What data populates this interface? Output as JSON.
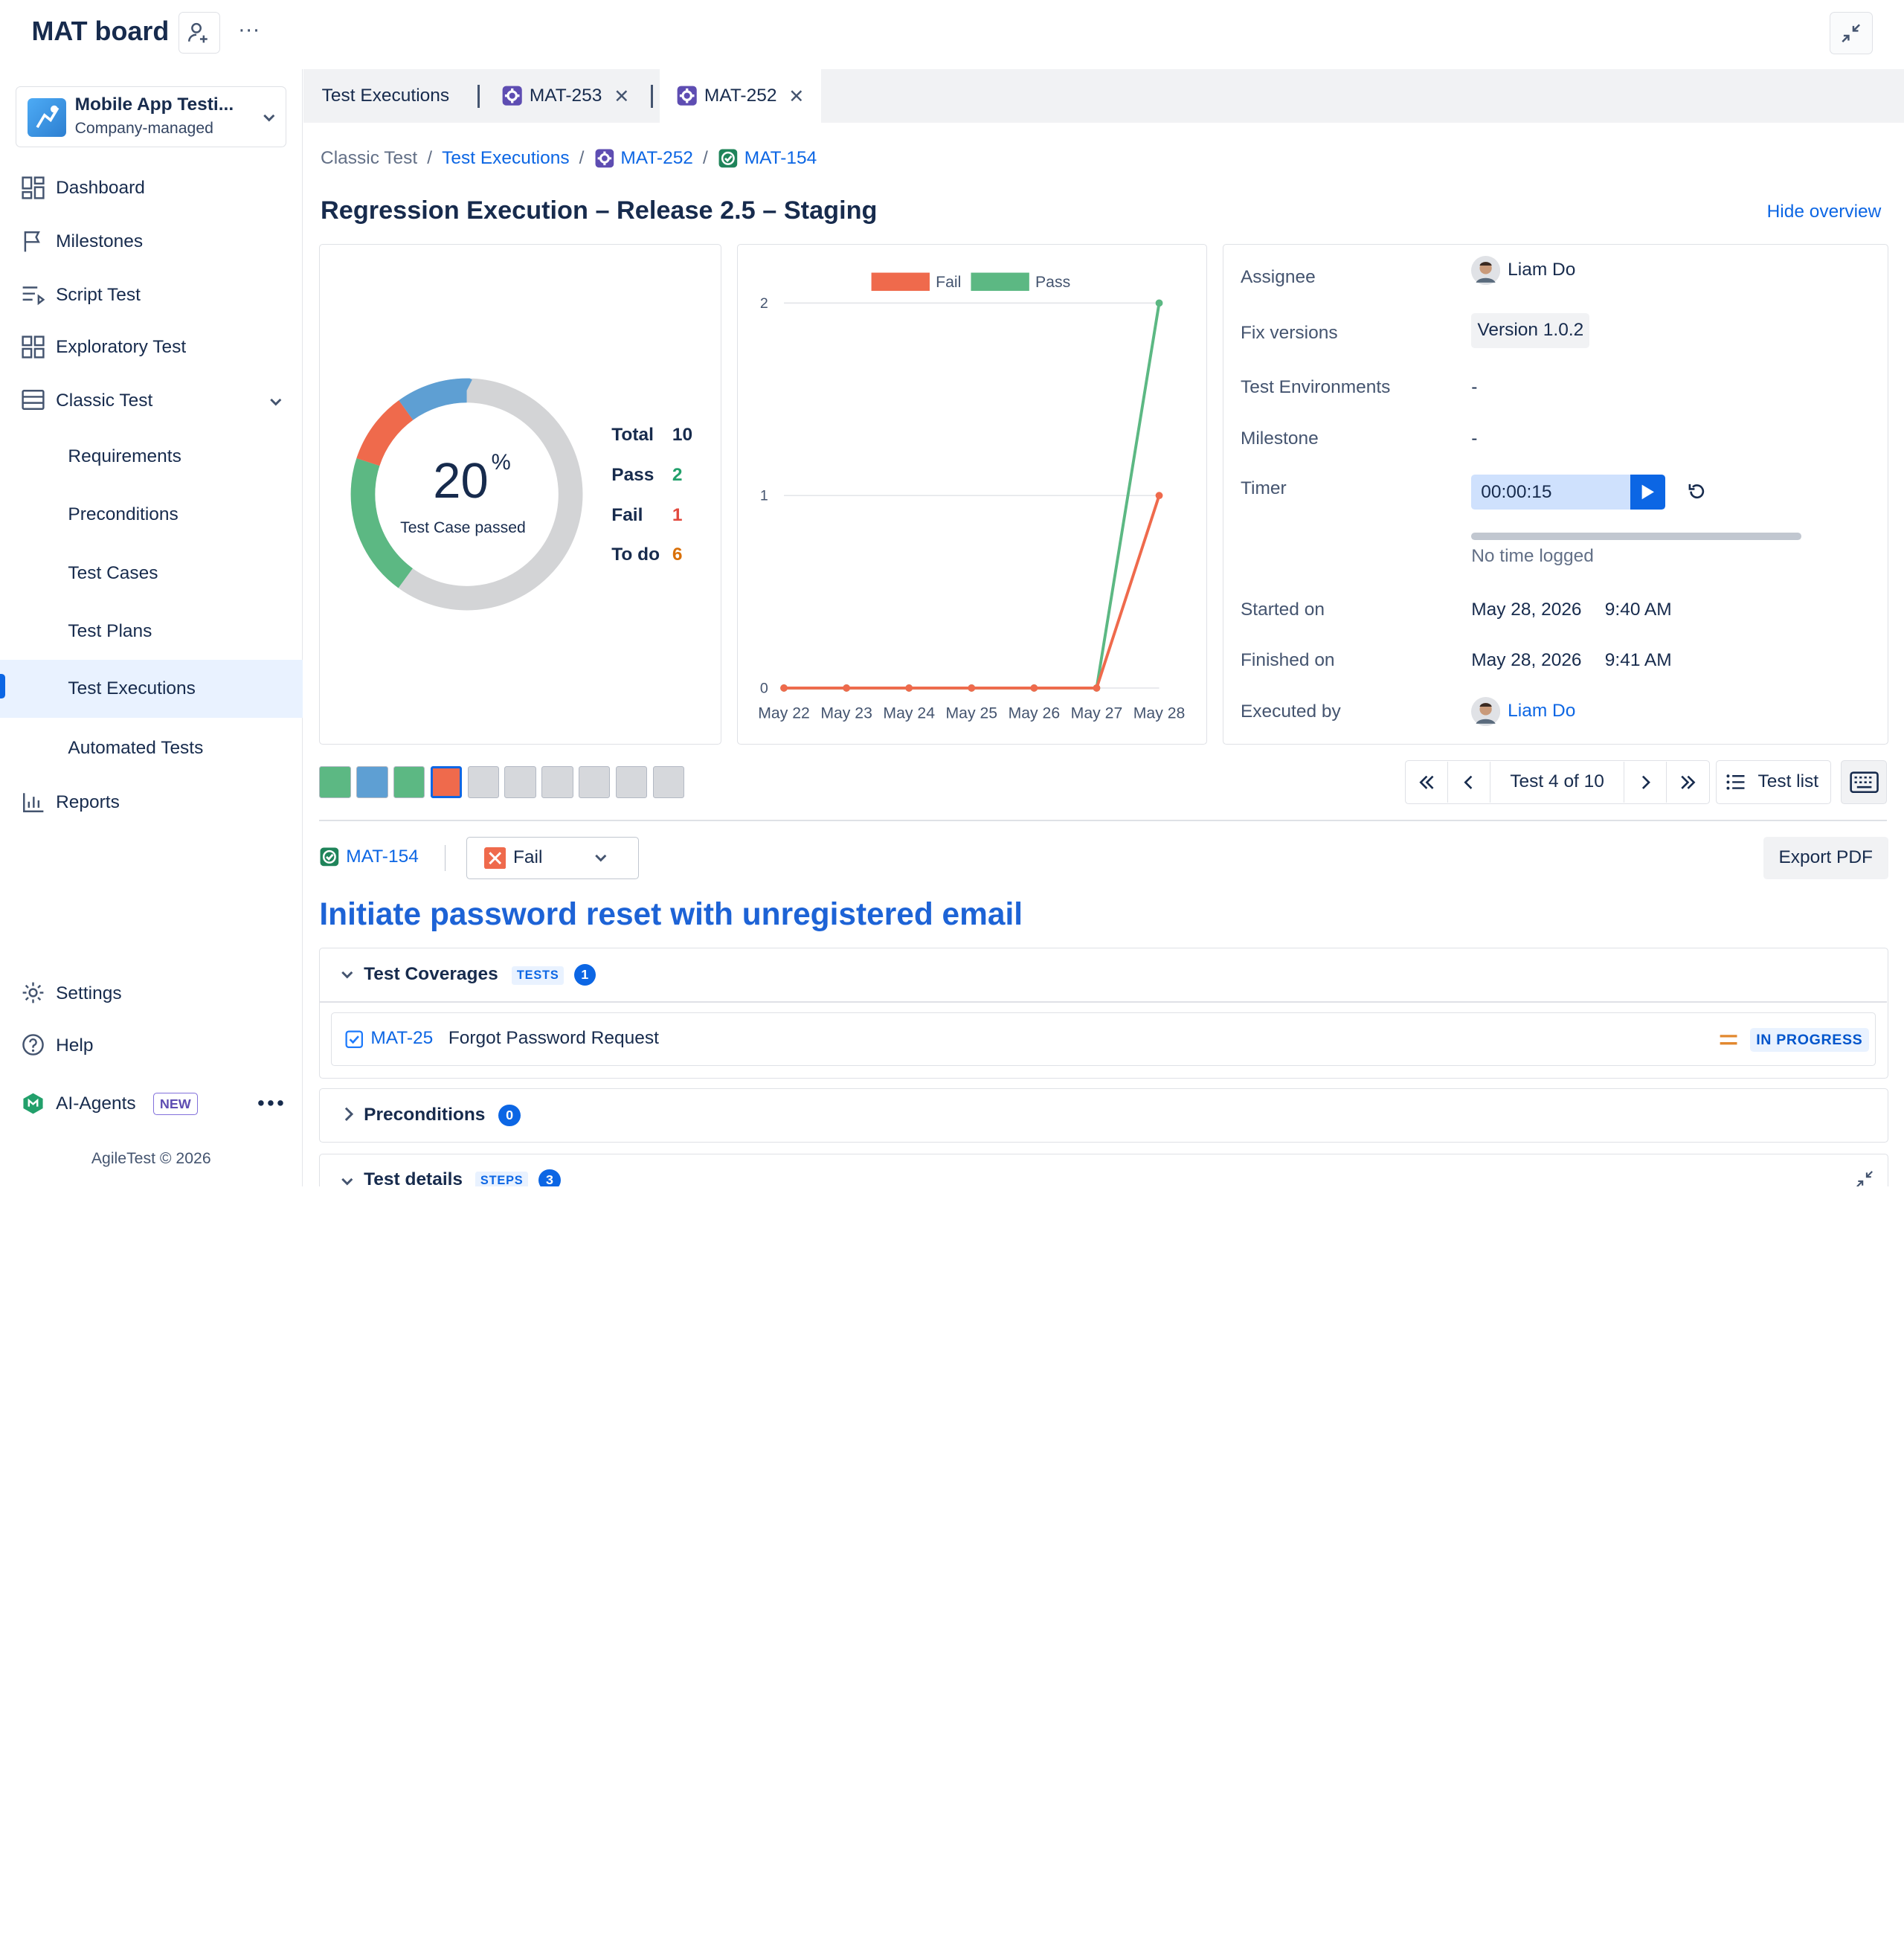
{
  "header": {
    "board_title": "MAT board",
    "more_label": "···"
  },
  "project": {
    "name": "Mobile App Testi...",
    "type": "Company-managed"
  },
  "sidebar": {
    "items": [
      {
        "label": "Dashboard",
        "icon": "dashboard-icon"
      },
      {
        "label": "Milestones",
        "icon": "flag-icon"
      },
      {
        "label": "Script Test",
        "icon": "script-icon"
      },
      {
        "label": "Exploratory Test",
        "icon": "grid-icon"
      },
      {
        "label": "Classic Test",
        "icon": "table-icon"
      },
      {
        "label": "Requirements"
      },
      {
        "label": "Preconditions"
      },
      {
        "label": "Test Cases"
      },
      {
        "label": "Test Plans"
      },
      {
        "label": "Test Executions"
      },
      {
        "label": "Automated Tests"
      },
      {
        "label": "Reports",
        "icon": "bar-chart-icon"
      }
    ],
    "bottom": [
      {
        "label": "Settings",
        "icon": "gear-icon"
      },
      {
        "label": "Help",
        "icon": "help-icon"
      },
      {
        "label": "AI-Agents",
        "icon": "ai-agent-icon",
        "badge": "NEW"
      }
    ],
    "footer": "AgileTest © 2026"
  },
  "tabs": [
    {
      "label": "Test Executions"
    },
    {
      "label": "MAT-253"
    },
    {
      "label": "MAT-252"
    }
  ],
  "breadcrumb": [
    "Classic Test",
    "Test Executions",
    "MAT-252",
    "MAT-154"
  ],
  "page": {
    "title": "Regression Execution – Release 2.5 – Staging",
    "hide_overview": "Hide overview"
  },
  "summary": {
    "percent": "20",
    "percent_sign": "%",
    "caption": "Test Case passed",
    "stats": [
      {
        "label": "Total",
        "value": "10",
        "color": "#172b4d"
      },
      {
        "label": "Pass",
        "value": "2",
        "color": "#22a06b"
      },
      {
        "label": "Fail",
        "value": "1",
        "color": "#e2483d"
      },
      {
        "label": "To do",
        "value": "6",
        "color": "#d97008"
      }
    ]
  },
  "chart_data": {
    "type": "line",
    "categories": [
      "May 22",
      "May 23",
      "May 24",
      "May 25",
      "May 26",
      "May 27",
      "May 28"
    ],
    "series": [
      {
        "name": "Fail",
        "color": "#ef6a4c",
        "values": [
          0,
          0,
          0,
          0,
          0,
          0,
          1
        ]
      },
      {
        "name": "Pass",
        "color": "#5cb883",
        "values": [
          0,
          0,
          0,
          0,
          0,
          0,
          2
        ]
      }
    ],
    "yticks": [
      "0",
      "1",
      "2"
    ],
    "ylim": [
      0,
      2
    ],
    "legend": "top",
    "grid": true
  },
  "details": {
    "assignee_label": "Assignee",
    "assignee": "Liam Do",
    "fix_label": "Fix versions",
    "fix_value": "Version 1.0.2",
    "env_label": "Test Environments",
    "env_value": "-",
    "milestone_label": "Milestone",
    "milestone_value": "-",
    "timer_label": "Timer",
    "timer_value": "00:00:15",
    "no_time": "No time logged",
    "started_label": "Started on",
    "started_date": "May 28, 2026",
    "started_time": "9:40 AM",
    "finished_label": "Finished on",
    "finished_date": "May 28, 2026",
    "finished_time": "9:41 AM",
    "executed_label": "Executed by",
    "executed_by": "Liam Do"
  },
  "strip": [
    "#5cb883",
    "#5e9fd3",
    "#5cb883",
    "#ef6a4c",
    "#d6d8dc",
    "#d6d8dc",
    "#d6d8dc",
    "#d6d8dc",
    "#d6d8dc",
    "#d6d8dc"
  ],
  "pager": {
    "label": "Test 4 of 10",
    "test_list": "Test list"
  },
  "case": {
    "key": "MAT-154",
    "status": "Fail",
    "export": "Export PDF",
    "title": "Initiate password reset with unregistered email"
  },
  "coverage": {
    "title": "Test Coverages",
    "tag": "TESTS",
    "count": "1",
    "item_key": "MAT-25",
    "item_title": "Forgot Password Request",
    "item_status": "IN PROGRESS"
  },
  "preconditions": {
    "title": "Preconditions",
    "count": "0"
  },
  "test_details": {
    "title": "Test details",
    "tag": "STEPS",
    "count": "3"
  }
}
